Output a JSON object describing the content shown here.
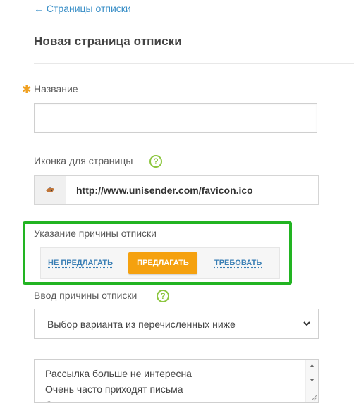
{
  "nav": {
    "back_label": "← Страницы отписки"
  },
  "page": {
    "title": "Новая страница отписки"
  },
  "form": {
    "name": {
      "required_mark": "✱",
      "label": "Название",
      "value": ""
    },
    "icon": {
      "label": "Иконка для страницы",
      "help": "?",
      "url": "http://www.unisender.com/favicon.ico"
    },
    "reason_mode": {
      "label": "Указание причины отписки",
      "options": [
        "НЕ ПРЕДЛАГАТЬ",
        "ПРЕДЛАГАТЬ",
        "ТРЕБОВАТЬ"
      ],
      "selected": "ПРЕДЛАГАТЬ"
    },
    "reason_input": {
      "label": "Ввод причины отписки",
      "help": "?",
      "selected": "Выбор варианта из перечисленных ниже"
    },
    "reasons_text": {
      "lines": [
        "Рассылка больше не интересна",
        "Очень часто приходят письма",
        "С"
      ]
    }
  },
  "colors": {
    "accent": "#f5a10f",
    "link": "#3a8fc7",
    "highlight": "#22b422",
    "help": "#8cc63f"
  }
}
